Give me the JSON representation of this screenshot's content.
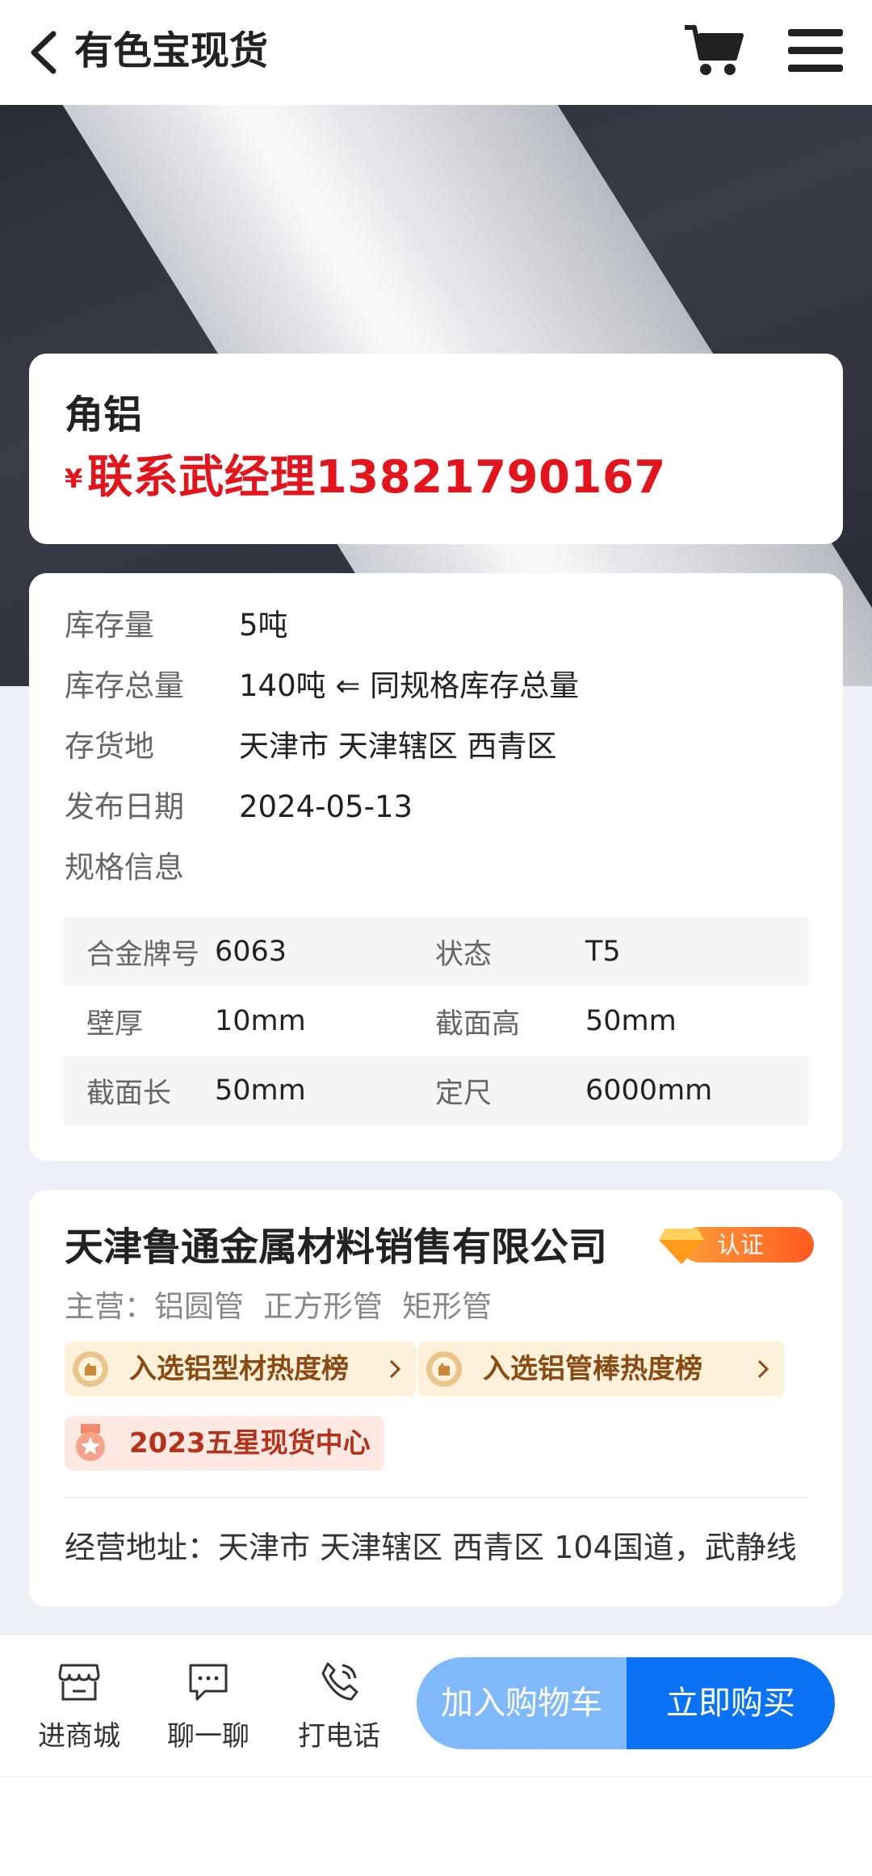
{
  "header": {
    "title": "有色宝现货"
  },
  "product": {
    "name": "角铝",
    "price_currency": "¥",
    "price_text": "联系武经理13821790167"
  },
  "details": {
    "stock": {
      "label": "库存量",
      "value": "5吨"
    },
    "total_stock": {
      "label": "库存总量",
      "value": "140吨 ⇐ 同规格库存总量"
    },
    "location": {
      "label": "存货地",
      "value": "天津市 天津辖区 西青区"
    },
    "publish_date": {
      "label": "发布日期",
      "value": "2024-05-13"
    },
    "spec_info": {
      "label": "规格信息"
    }
  },
  "specs": [
    {
      "label1": "合金牌号",
      "value1": "6063",
      "label2": "状态",
      "value2": "T5"
    },
    {
      "label1": "壁厚",
      "value1": "10mm",
      "label2": "截面高",
      "value2": "50mm"
    },
    {
      "label1": "截面长",
      "value1": "50mm",
      "label2": "定尺",
      "value2": "6000mm"
    }
  ],
  "company": {
    "name": "天津鲁通金属材料销售有限公司",
    "cert_label": "认证",
    "main_business_label": "主营：",
    "main_business": [
      "铝圆管",
      "正方形管",
      "矩形管"
    ],
    "tags": [
      {
        "text": "入选铝型材热度榜"
      },
      {
        "text": "入选铝管棒热度榜"
      },
      {
        "text": "2023五星现货中心"
      }
    ],
    "address": "经营地址：天津市 天津辖区 西青区 104国道，武静线"
  },
  "bottom_bar": {
    "shop_label": "进商城",
    "chat_label": "聊一聊",
    "call_label": "打电话",
    "add_cart_label": "加入购物车",
    "buy_now_label": "立即购买"
  },
  "colors": {
    "price": "#e3141b",
    "primary_button": "#0a72f5",
    "secondary_button": "#7fb8fb",
    "badge_gradient_start": "#ff9d3a",
    "badge_gradient_end": "#ff5b1f"
  }
}
